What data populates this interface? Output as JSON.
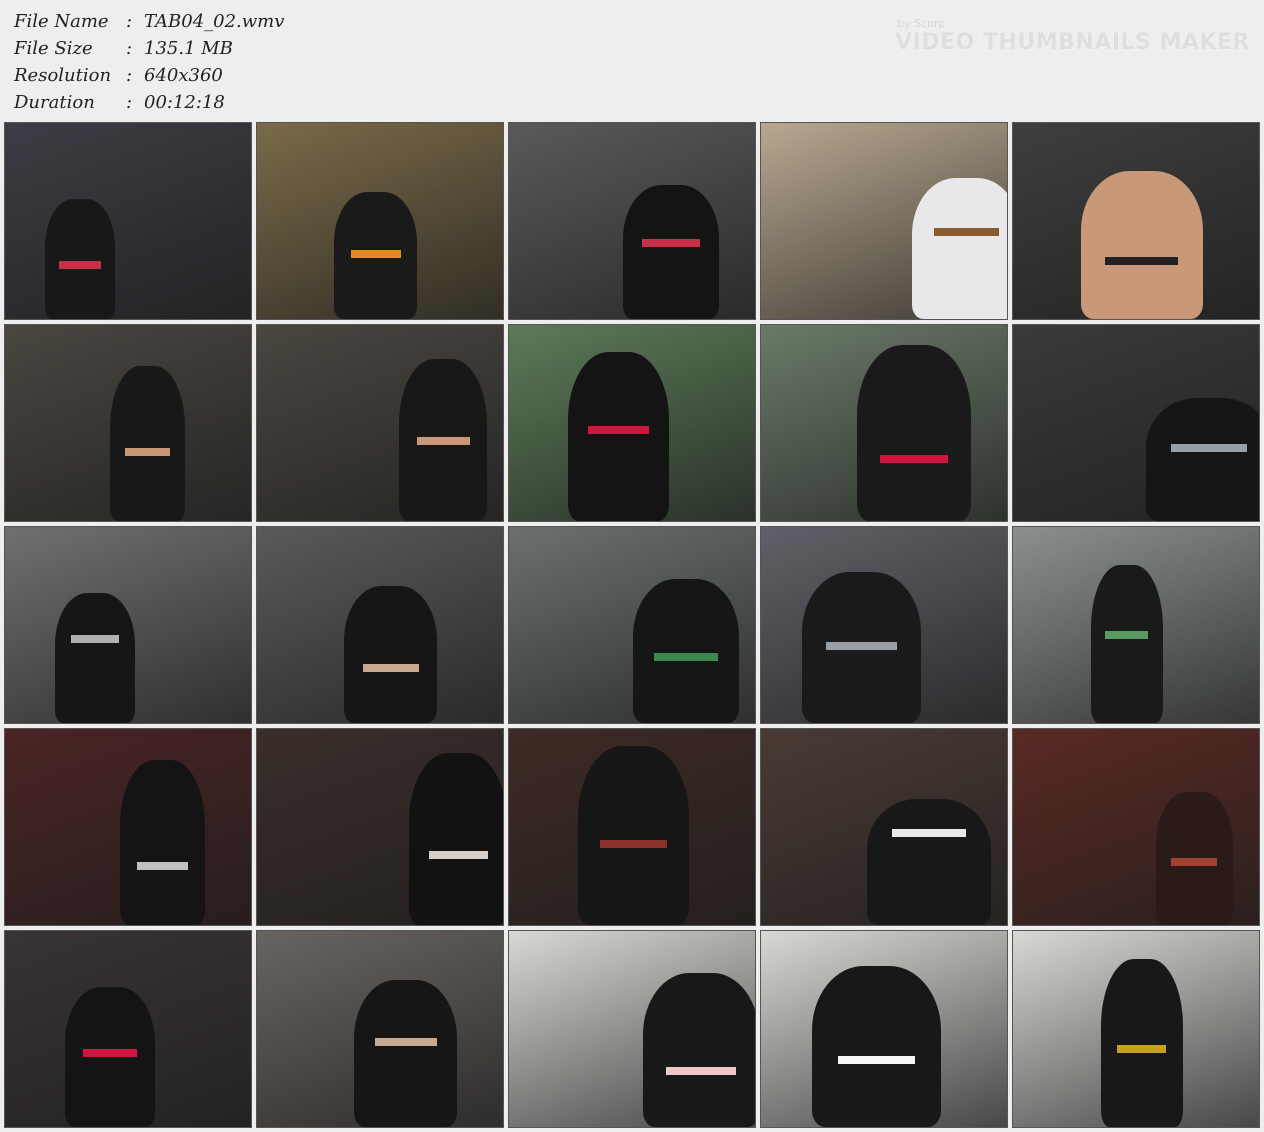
{
  "info": {
    "rows": [
      {
        "label": "File Name",
        "sep": ":",
        "value": "TAB04_02.wmv"
      },
      {
        "label": "File Size",
        "sep": ":",
        "value": "135.1 MB"
      },
      {
        "label": "Resolution",
        "sep": ":",
        "value": "640x360"
      },
      {
        "label": "Duration",
        "sep": ":",
        "value": "00:12:18"
      }
    ]
  },
  "brand": {
    "by": "by Scorp",
    "name": "VIDEO THUMBNAILS MAKER"
  },
  "thumbnails": [
    {
      "bg": "#3c3c44",
      "fig": "#181818",
      "accent": "#c8304a"
    },
    {
      "bg": "#7a6a48",
      "fig": "#1a1a1a",
      "accent": "#e38a1a"
    },
    {
      "bg": "#5a5a5a",
      "fig": "#141414",
      "accent": "#c8304a"
    },
    {
      "bg": "#b8a890",
      "fig": "#e8e8ea",
      "accent": "#8a5a30"
    },
    {
      "bg": "#3e3e3e",
      "fig": "#c89878",
      "accent": "#222222"
    },
    {
      "bg": "#4a4640",
      "fig": "#181818",
      "accent": "#c89878"
    },
    {
      "bg": "#4a4640",
      "fig": "#181818",
      "accent": "#c89878"
    },
    {
      "bg": "#5c7a58",
      "fig": "#141414",
      "accent": "#d0163e"
    },
    {
      "bg": "#6a7a68",
      "fig": "#1a1a1a",
      "accent": "#d0163e"
    },
    {
      "bg": "#3a3a3a",
      "fig": "#161616",
      "accent": "#9aa0a8"
    },
    {
      "bg": "#707070",
      "fig": "#161616",
      "accent": "#b0b0b0"
    },
    {
      "bg": "#5a5a5a",
      "fig": "#161616",
      "accent": "#c8a890"
    },
    {
      "bg": "#6a7070",
      "fig": "#161616",
      "accent": "#3a8a50"
    },
    {
      "bg": "#606068",
      "fig": "#1a1a1a",
      "accent": "#9aa0a8"
    },
    {
      "bg": "#8a9090",
      "fig": "#1a1a1a",
      "accent": "#5a9a60"
    },
    {
      "bg": "#4a2424",
      "fig": "#141414",
      "accent": "#c0c0c0"
    },
    {
      "bg": "#3a2e2a",
      "fig": "#121212",
      "accent": "#d8d0c8"
    },
    {
      "bg": "#3e2a24",
      "fig": "#161616",
      "accent": "#8a3028"
    },
    {
      "bg": "#4a3a34",
      "fig": "#181818",
      "accent": "#e8e8e8"
    },
    {
      "bg": "#5a2a24",
      "fig": "#2a1a18",
      "accent": "#a04030"
    },
    {
      "bg": "#3a3434",
      "fig": "#141414",
      "accent": "#d0163e"
    },
    {
      "bg": "#6a6460",
      "fig": "#161616",
      "accent": "#c8a890"
    },
    {
      "bg": "#d8d8d4",
      "fig": "#181818",
      "accent": "#f0c8c8"
    },
    {
      "bg": "#d8d8d4",
      "fig": "#181818",
      "accent": "#f4f4f4"
    },
    {
      "bg": "#d8d8d4",
      "fig": "#181818",
      "accent": "#c8a020"
    }
  ]
}
